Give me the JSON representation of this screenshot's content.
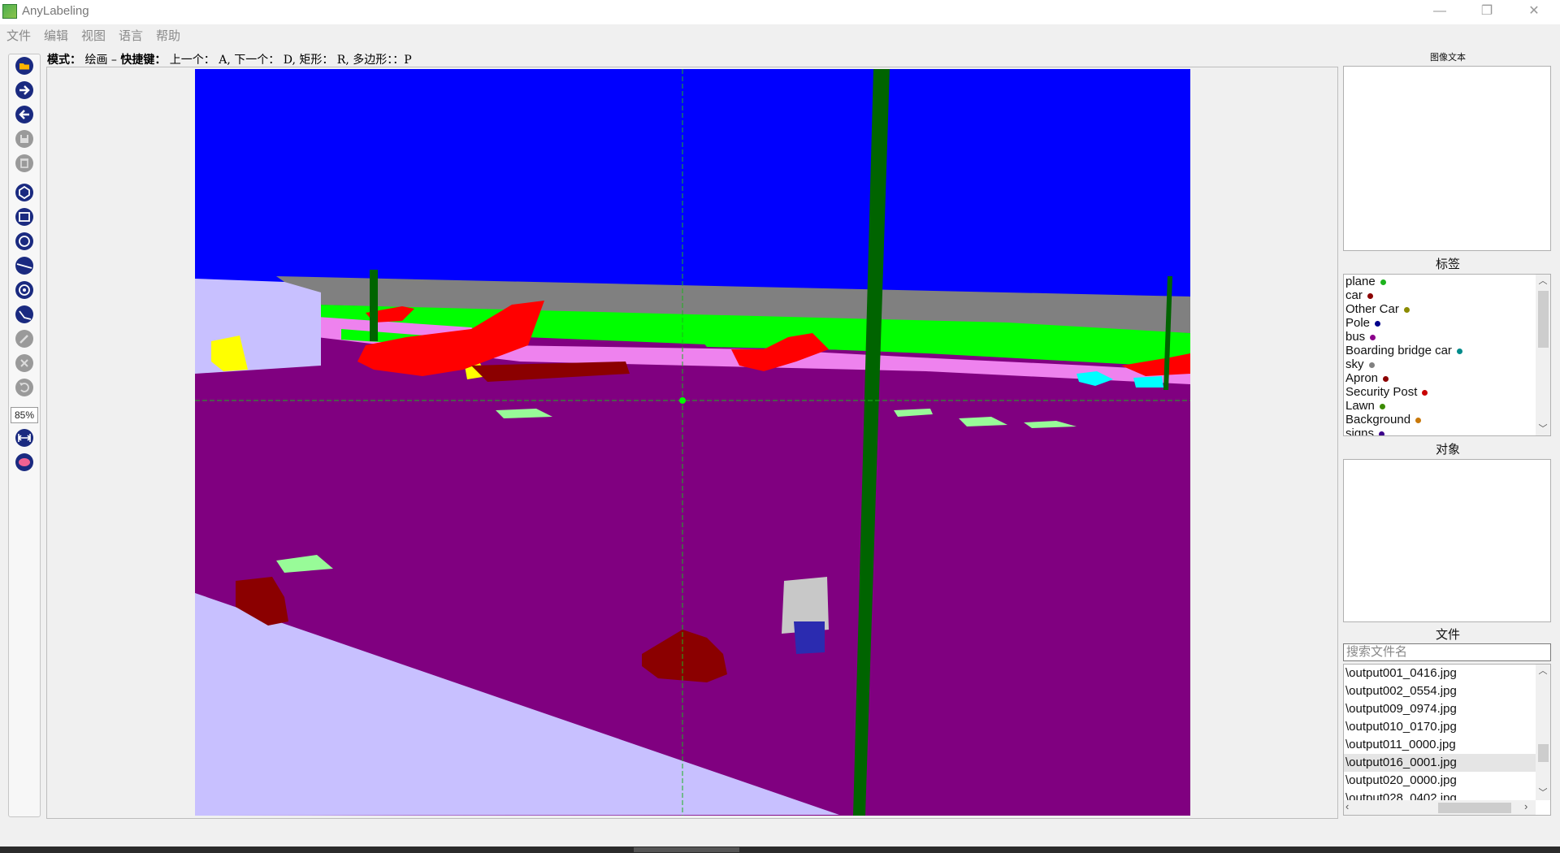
{
  "window": {
    "title": "AnyLabeling",
    "controls": [
      "—",
      "❐",
      "✕"
    ]
  },
  "menu": [
    "文件",
    "编辑",
    "视图",
    "语言",
    "帮助"
  ],
  "toolbar": {
    "zoom": "85%",
    "icons": [
      "open-folder-icon",
      "next-image-icon",
      "prev-image-icon",
      "save-icon",
      "delete-icon",
      "polygon-icon",
      "rectangle-icon",
      "circle-icon",
      "line-icon",
      "point-icon",
      "linestrip-icon",
      "edit-icon",
      "delete-shape-icon",
      "undo-icon",
      "fit-width-icon",
      "brain-icon"
    ]
  },
  "hint": {
    "mode_label": "模式：",
    "mode_value": " 绘画 – ",
    "shortcut_label": "快捷键：",
    "shortcut_value": " 上一个： A, 下一个： D, 矩形： R, 多边形：：P"
  },
  "panels": {
    "image_text_title": "图像文本",
    "labels_title": "标签",
    "objects_title": "对象",
    "files_title": "文件",
    "search_placeholder": "搜索文件名"
  },
  "labels": [
    {
      "name": "plane",
      "color": "#1db31d"
    },
    {
      "name": "car",
      "color": "#8b0000"
    },
    {
      "name": "Other Car",
      "color": "#8b8b00"
    },
    {
      "name": "Pole",
      "color": "#00008b"
    },
    {
      "name": "bus",
      "color": "#8b008b"
    },
    {
      "name": "Boarding bridge car",
      "color": "#008b8b"
    },
    {
      "name": "sky",
      "color": "#808080"
    },
    {
      "name": "Apron",
      "color": "#8b0000"
    },
    {
      "name": "Security Post",
      "color": "#c80000"
    },
    {
      "name": "Lawn",
      "color": "#3c8b00"
    },
    {
      "name": "Background",
      "color": "#c8780a"
    },
    {
      "name": "signs",
      "color": "#3c008b"
    }
  ],
  "files": [
    "\\output001_0416.jpg",
    "\\output002_0554.jpg",
    "\\output009_0974.jpg",
    "\\output010_0170.jpg",
    "\\output011_0000.jpg",
    "\\output016_0001.jpg",
    "\\output020_0000.jpg",
    "\\output028_0402.jpg"
  ],
  "selected_file_index": 5
}
